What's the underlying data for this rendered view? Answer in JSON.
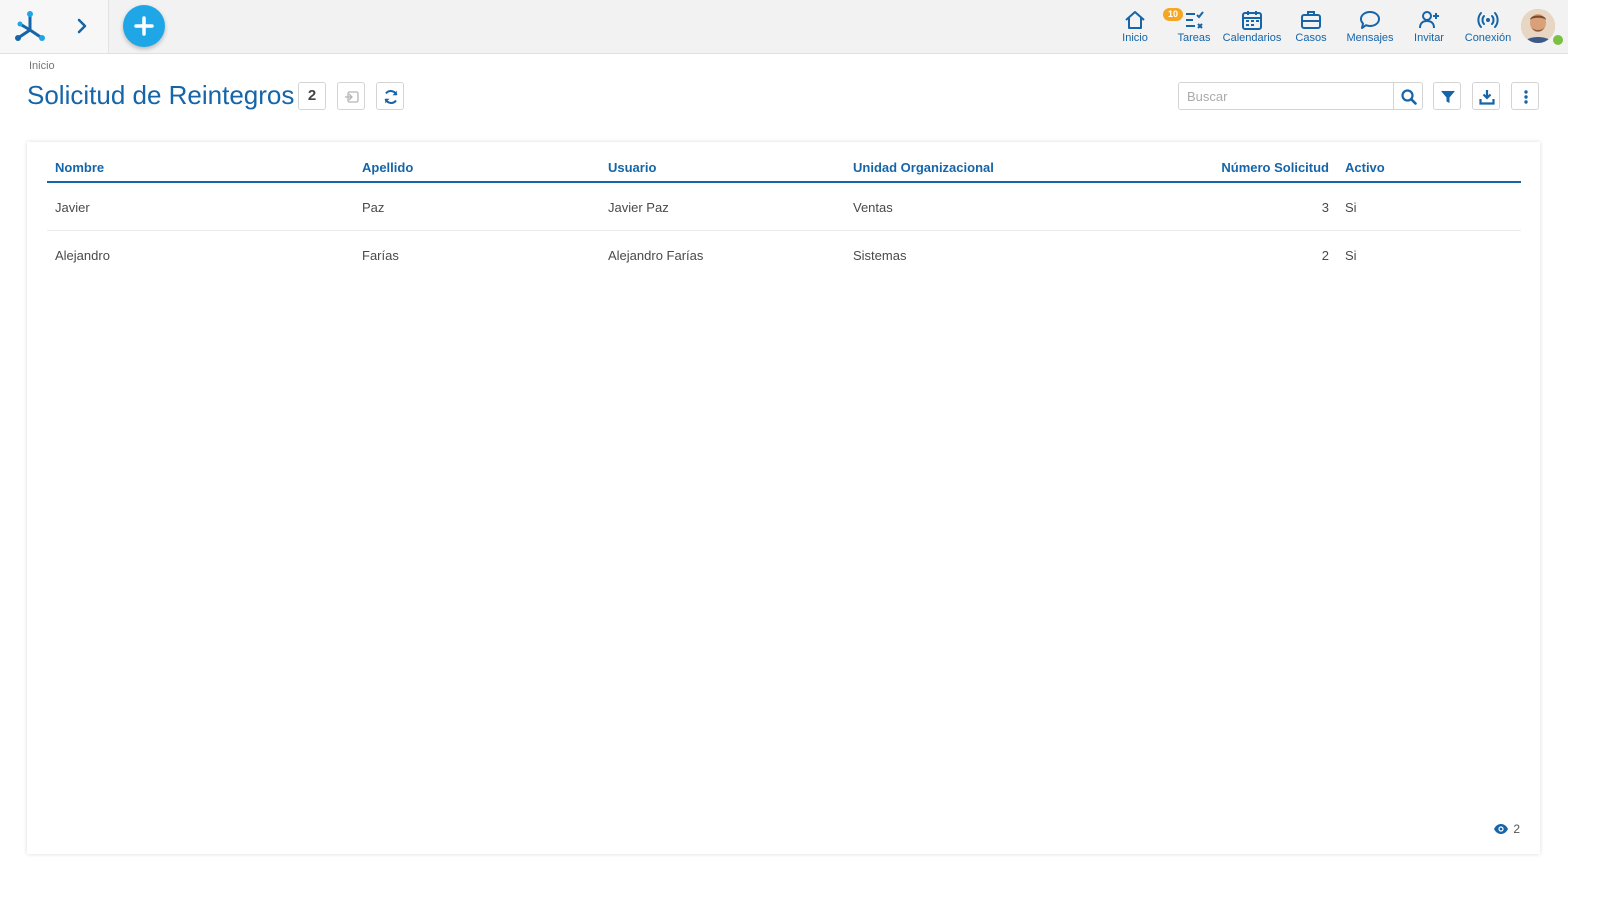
{
  "topbar": {
    "nav": [
      {
        "key": "inicio",
        "label": "Inicio",
        "icon": "home-icon"
      },
      {
        "key": "tareas",
        "label": "Tareas",
        "icon": "tasks-icon",
        "badge": "10"
      },
      {
        "key": "calendarios",
        "label": "Calendarios",
        "icon": "calendar-icon"
      },
      {
        "key": "casos",
        "label": "Casos",
        "icon": "briefcase-icon"
      },
      {
        "key": "mensajes",
        "label": "Mensajes",
        "icon": "chat-icon"
      },
      {
        "key": "invitar",
        "label": "Invitar",
        "icon": "invite-user-icon"
      },
      {
        "key": "conexion",
        "label": "Conexión",
        "icon": "connection-icon"
      }
    ]
  },
  "breadcrumb": "Inicio",
  "page": {
    "title": "Solicitud de Reintegros",
    "count": "2"
  },
  "search": {
    "placeholder": "Buscar",
    "value": ""
  },
  "table": {
    "columns": [
      "Nombre",
      "Apellido",
      "Usuario",
      "Unidad Organizacional",
      "Número Solicitud",
      "Activo"
    ],
    "rows": [
      [
        "Javier",
        "Paz",
        "Javier Paz",
        "Ventas",
        "3",
        "Si"
      ],
      [
        "Alejandro",
        "Farías",
        "Alejandro Farías",
        "Sistemas",
        "2",
        "Si"
      ]
    ]
  },
  "footer": {
    "visible_count": "2"
  },
  "colors": {
    "primary": "#1565a8",
    "accent": "#1fa6e7",
    "badge": "#f5a623",
    "presence": "#7ac143"
  }
}
